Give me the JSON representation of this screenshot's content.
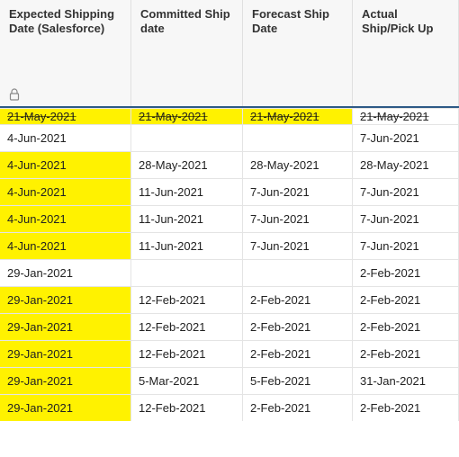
{
  "columns": [
    "Expected Shipping Date (Salesforce)",
    "Committed Ship date",
    "Forecast Ship Date",
    "Actual Ship/Pick Up"
  ],
  "rows": [
    {
      "cells": [
        "21-May-2021",
        "21-May-2021",
        "21-May-2021",
        "21-May-2021"
      ],
      "hl": [
        true,
        true,
        true,
        false
      ],
      "cut": true,
      "strike": true
    },
    {
      "cells": [
        "4-Jun-2021",
        "",
        "",
        "7-Jun-2021"
      ],
      "hl": [
        false,
        false,
        false,
        false
      ]
    },
    {
      "cells": [
        "4-Jun-2021",
        "28-May-2021",
        "28-May-2021",
        "28-May-2021"
      ],
      "hl": [
        true,
        false,
        false,
        false
      ]
    },
    {
      "cells": [
        "4-Jun-2021",
        "11-Jun-2021",
        "7-Jun-2021",
        "7-Jun-2021"
      ],
      "hl": [
        true,
        false,
        false,
        false
      ]
    },
    {
      "cells": [
        "4-Jun-2021",
        "11-Jun-2021",
        "7-Jun-2021",
        "7-Jun-2021"
      ],
      "hl": [
        true,
        false,
        false,
        false
      ]
    },
    {
      "cells": [
        "4-Jun-2021",
        "11-Jun-2021",
        "7-Jun-2021",
        "7-Jun-2021"
      ],
      "hl": [
        true,
        false,
        false,
        false
      ]
    },
    {
      "cells": [
        "29-Jan-2021",
        "",
        "",
        "2-Feb-2021"
      ],
      "hl": [
        false,
        false,
        false,
        false
      ]
    },
    {
      "cells": [
        "29-Jan-2021",
        "12-Feb-2021",
        "2-Feb-2021",
        "2-Feb-2021"
      ],
      "hl": [
        true,
        false,
        false,
        false
      ]
    },
    {
      "cells": [
        "29-Jan-2021",
        "12-Feb-2021",
        "2-Feb-2021",
        "2-Feb-2021"
      ],
      "hl": [
        true,
        false,
        false,
        false
      ]
    },
    {
      "cells": [
        "29-Jan-2021",
        "12-Feb-2021",
        "2-Feb-2021",
        "2-Feb-2021"
      ],
      "hl": [
        true,
        false,
        false,
        false
      ]
    },
    {
      "cells": [
        "29-Jan-2021",
        "5-Mar-2021",
        "5-Feb-2021",
        "31-Jan-2021"
      ],
      "hl": [
        true,
        false,
        false,
        false
      ]
    },
    {
      "cells": [
        "29-Jan-2021",
        "12-Feb-2021",
        "2-Feb-2021",
        "2-Feb-2021"
      ],
      "hl": [
        true,
        false,
        false,
        false
      ]
    }
  ]
}
